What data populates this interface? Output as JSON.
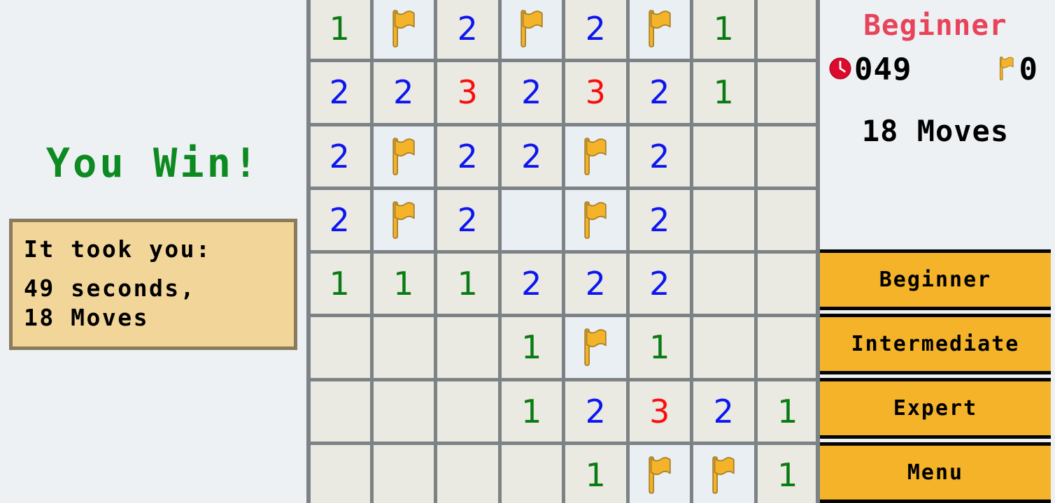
{
  "left_panel": {
    "win_title": "You Win!",
    "result_box": {
      "intro": "It took you:",
      "line_time": "49 seconds,",
      "line_moves": "18 Moves"
    }
  },
  "board": {
    "rows": 8,
    "columns": 8,
    "cells": [
      [
        {
          "t": "1"
        },
        {
          "t": "flag"
        },
        {
          "t": "2"
        },
        {
          "t": "flag"
        },
        {
          "t": "2"
        },
        {
          "t": "flag"
        },
        {
          "t": "1"
        },
        {
          "t": ""
        }
      ],
      [
        {
          "t": "2"
        },
        {
          "t": "2"
        },
        {
          "t": "3"
        },
        {
          "t": "2"
        },
        {
          "t": "3"
        },
        {
          "t": "2"
        },
        {
          "t": "1"
        },
        {
          "t": ""
        }
      ],
      [
        {
          "t": "2"
        },
        {
          "t": "flag"
        },
        {
          "t": "2"
        },
        {
          "t": "2"
        },
        {
          "t": "flag"
        },
        {
          "t": "2"
        },
        {
          "t": ""
        },
        {
          "t": ""
        }
      ],
      [
        {
          "t": "2"
        },
        {
          "t": "flag"
        },
        {
          "t": "2"
        },
        {
          "t": "blank"
        },
        {
          "t": "flag"
        },
        {
          "t": "2"
        },
        {
          "t": ""
        },
        {
          "t": ""
        }
      ],
      [
        {
          "t": "1"
        },
        {
          "t": "1"
        },
        {
          "t": "1"
        },
        {
          "t": "2"
        },
        {
          "t": "2"
        },
        {
          "t": "2"
        },
        {
          "t": ""
        },
        {
          "t": ""
        }
      ],
      [
        {
          "t": ""
        },
        {
          "t": ""
        },
        {
          "t": ""
        },
        {
          "t": "1"
        },
        {
          "t": "flag"
        },
        {
          "t": "1"
        },
        {
          "t": ""
        },
        {
          "t": ""
        }
      ],
      [
        {
          "t": ""
        },
        {
          "t": ""
        },
        {
          "t": ""
        },
        {
          "t": "1"
        },
        {
          "t": "2"
        },
        {
          "t": "3"
        },
        {
          "t": "2"
        },
        {
          "t": "1"
        }
      ],
      [
        {
          "t": ""
        },
        {
          "t": ""
        },
        {
          "t": ""
        },
        {
          "t": ""
        },
        {
          "t": "1"
        },
        {
          "t": "flag"
        },
        {
          "t": "flag"
        },
        {
          "t": "1"
        }
      ]
    ]
  },
  "right_panel": {
    "difficulty_title": "Beginner",
    "timer_value": "049",
    "flags_value": "0",
    "moves_text": "18 Moves",
    "clock_icon": "clock-icon",
    "flag_icon": "flag-icon",
    "buttons": [
      {
        "label": "Beginner"
      },
      {
        "label": "Intermediate"
      },
      {
        "label": "Expert"
      },
      {
        "label": "Menu"
      }
    ]
  },
  "colors": {
    "panel_bg": "#edf1f4",
    "grid_line": "#7c8285",
    "cell_bg": "#eaeae2",
    "cell_flag_bg": "#eaeff3",
    "flag_orange": "#f5b32a",
    "number_1": "#0a7b12",
    "number_2": "#0d16f0",
    "number_3": "#fb0d0d",
    "win_green": "#0d8a20",
    "title_red": "#e8435a",
    "box_bg": "#f2d598",
    "box_border": "#8a7b5d",
    "button_bg": "#f5b32a",
    "clock_red": "#dc0a2d"
  }
}
